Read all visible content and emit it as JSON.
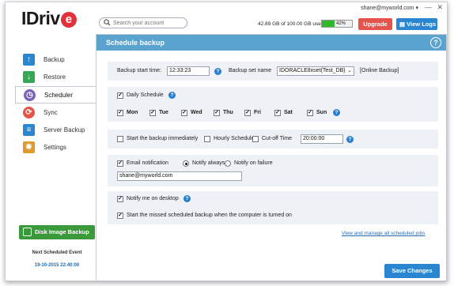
{
  "header": {
    "logo_text": "IDriv",
    "logo_e": "e",
    "user_email": "shane@myworld.com ▾",
    "minimize_glyph": "—",
    "close_glyph": "✕",
    "search_placeholder": "Search your account",
    "usage_text": "42.89 GB of 100.00 GB used",
    "usage_percent_label": "42%",
    "usage_fraction": 0.42,
    "upgrade_label": "Upgrade",
    "view_logs_label": "View Logs"
  },
  "sidebar": {
    "items": [
      {
        "label": "Backup",
        "icon": "upload-arrow-icon",
        "color": "#2a86d1"
      },
      {
        "label": "Restore",
        "icon": "download-arrow-icon",
        "color": "#34a853"
      },
      {
        "label": "Scheduler",
        "icon": "clock-icon",
        "color": "#7b62b8"
      },
      {
        "label": "Sync",
        "icon": "sync-icon",
        "color": "#e4544a"
      },
      {
        "label": "Server Backup",
        "icon": "server-icon",
        "color": "#2a86d1"
      },
      {
        "label": "Settings",
        "icon": "gear-icon",
        "color": "#e09a2a"
      }
    ],
    "disk_image_label": "Disk Image Backup",
    "next_event_title": "Next Scheduled Event",
    "next_event_date": "19-10-2015 22:40:00"
  },
  "panel": {
    "title": "Schedule backup",
    "help_glyph": "?",
    "start_time_label": "Backup start time:",
    "start_time_value": "12:33:23",
    "backup_set_label": "Backup set name",
    "backup_set_value": "IDORACLE8xset(Test_DB)",
    "backup_set_type": "[Online Backup]",
    "daily_schedule_label": "Daily Schedule",
    "days": [
      "Mon",
      "Tue",
      "Wed",
      "Thu",
      "Fri",
      "Sat",
      "Sun"
    ],
    "start_immediately_label": "Start the backup immediately",
    "hourly_label": "Hourly Schedule",
    "cutoff_label": "Cut-off Time",
    "cutoff_value": "20:00:00",
    "email_notification_label": "Email notification",
    "notify_always_label": "Notify always",
    "notify_failure_label": "Notify on failure",
    "email_value": "shane@myworld.com",
    "notify_desktop_label": "Notify me on desktop",
    "missed_backup_label": "Start the missed scheduled backup when the computer is turned on",
    "view_all_link": "View and manage all scheduled jobs",
    "save_label": "Save Changes"
  }
}
